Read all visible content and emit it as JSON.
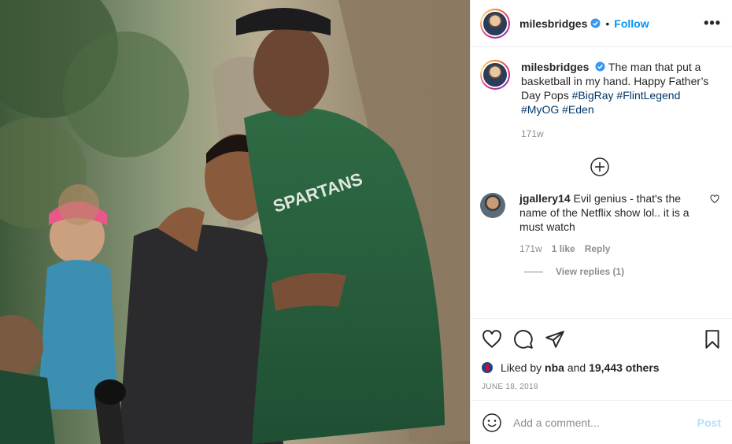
{
  "post": {
    "author": "milesbridges",
    "follow_label": "Follow",
    "dot": "•",
    "more": "•••",
    "caption": {
      "text": "The man that put a basketball in my hand. Happy Father’s Day Pops",
      "hashtags": [
        "#BigRay",
        "#FlintLegend",
        "#MyOG",
        "#Eden"
      ]
    },
    "caption_time": "171w",
    "photo": {
      "jersey_text": "SPARTANS"
    }
  },
  "comment": {
    "author": "jgallery14",
    "text": "Evil genius - that's the name of the Netflix show lol.. it is a must watch",
    "time": "171w",
    "likes": "1 like",
    "reply": "Reply",
    "view_replies": "View replies (1)"
  },
  "likes": {
    "prefix": "Liked by",
    "by": "nba",
    "and": "and",
    "others": "19,443 others"
  },
  "date": "JUNE 18, 2018",
  "add_comment": {
    "placeholder": "Add a comment...",
    "post_label": "Post"
  },
  "colors": {
    "accent": "#0095f6",
    "hashtag": "#00376b",
    "muted": "#8e8e8e",
    "post_disabled": "#b2dffc"
  },
  "icons": [
    "verified-badge-icon",
    "more-options-icon",
    "load-more-plus-icon",
    "comment-like-heart-icon",
    "like-heart-icon",
    "comment-bubble-icon",
    "share-plane-icon",
    "bookmark-icon",
    "emoji-smile-icon"
  ]
}
